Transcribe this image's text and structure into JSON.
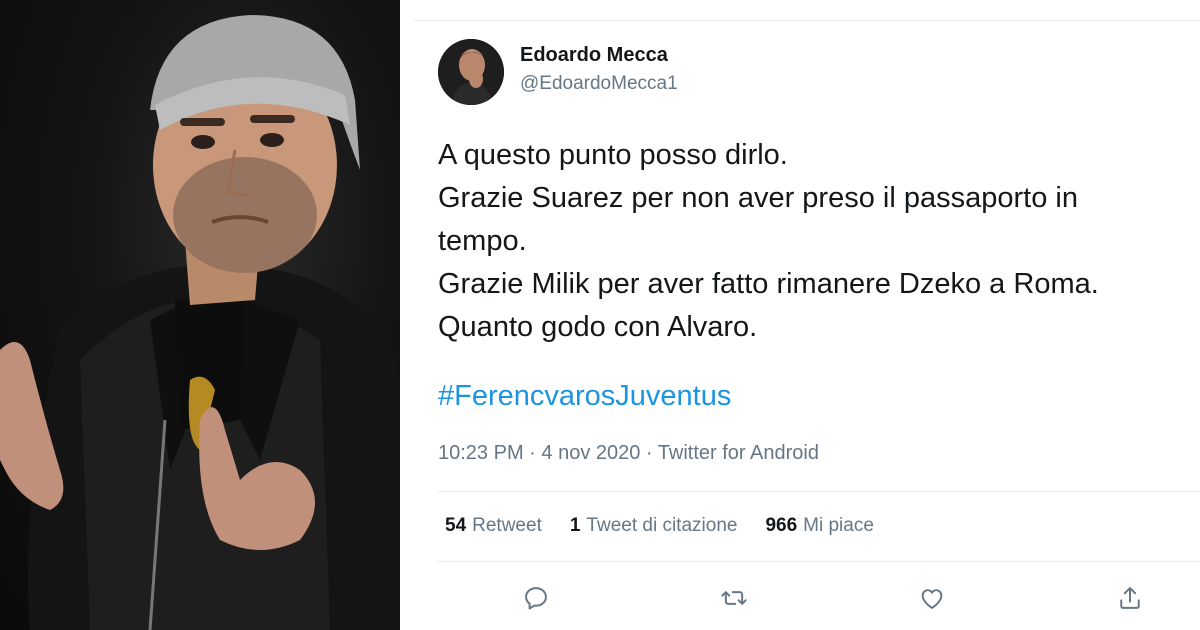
{
  "tweet": {
    "author": {
      "display_name": "Edoardo Mecca",
      "handle": "@EdoardoMecca1"
    },
    "text_lines": [
      "A questo punto posso dirlo.",
      "Grazie Suarez per non aver preso il passaporto in",
      "tempo.",
      "Grazie Milik per aver fatto rimanere Dzeko a Roma.",
      "Quanto godo con Alvaro."
    ],
    "hashtag": "#FerencvarosJuventus",
    "meta": {
      "time": "10:23 PM",
      "separator": " · ",
      "date": "4 nov 2020",
      "source": "Twitter for Android"
    },
    "stats": {
      "retweets": {
        "count": "54",
        "label": "Retweet"
      },
      "quotes": {
        "count": "1",
        "label": "Tweet di citazione"
      },
      "likes": {
        "count": "966",
        "label": "Mi piace"
      }
    },
    "actions": [
      "reply-icon",
      "retweet-icon",
      "like-icon",
      "share-icon"
    ]
  },
  "colors": {
    "link": "#1b95e0",
    "secondary_text": "#657786",
    "primary_text": "#14171a",
    "divider": "#e6ecf0",
    "action_icon": "#657786"
  }
}
